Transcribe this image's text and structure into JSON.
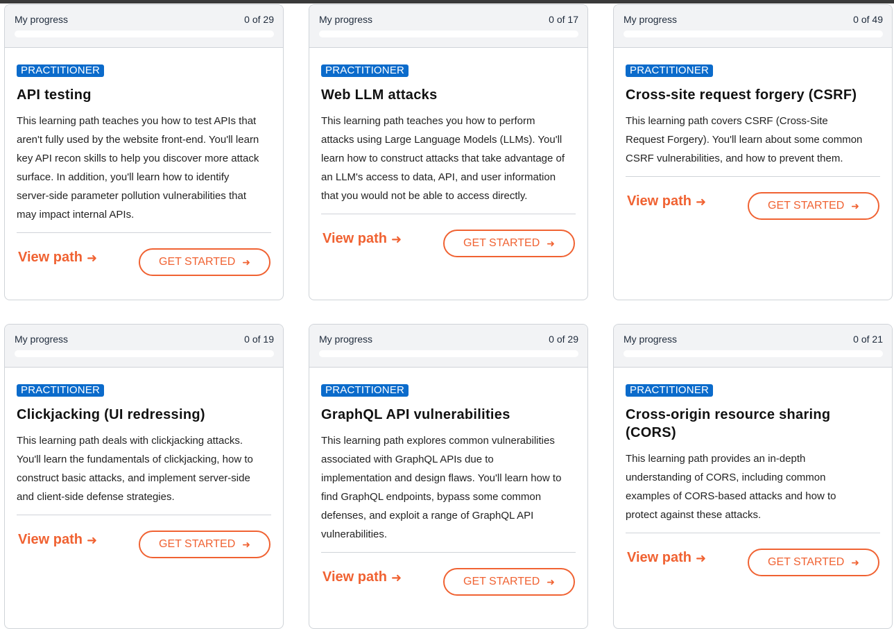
{
  "progress_label": "My progress",
  "badge_label": "PRACTITIONER",
  "view_path_label": "View path",
  "get_started_label": "GET STARTED",
  "accent_color": "#f06232",
  "badge_color": "#0b6bcb",
  "icons": {
    "arrow": "arrow-right-icon"
  },
  "cards": [
    {
      "progress_count": "0 of 29",
      "progress_fraction": 0,
      "title": "API testing",
      "description_lines": [
        "This learning path teaches you how to test APIs that",
        "aren't fully used by the website front-end. You'll learn",
        "key API recon skills to help you discover more attack",
        "surface. In addition, you'll learn how to identify",
        "server-side parameter pollution vulnerabilities that",
        "may impact internal APIs."
      ]
    },
    {
      "progress_count": "0 of 17",
      "progress_fraction": 0,
      "title": "Web LLM attacks",
      "description_lines": [
        "This learning path teaches you how to perform",
        "attacks using Large Language Models (LLMs). You'll",
        "learn how to construct attacks that take advantage of",
        "an LLM's access to data, API, and user information",
        "that you would not be able to access directly."
      ]
    },
    {
      "progress_count": "0 of 49",
      "progress_fraction": 0,
      "title": "Cross-site request forgery (CSRF)",
      "description_lines": [
        "This learning path covers CSRF (Cross-Site",
        "Request Forgery). You'll learn about some common",
        "CSRF vulnerabilities, and how to prevent them."
      ]
    },
    {
      "progress_count": "0 of 19",
      "progress_fraction": 0,
      "title": "Clickjacking (UI redressing)",
      "description_lines": [
        "This learning path deals with clickjacking attacks.",
        "You'll learn the fundamentals of clickjacking, how to",
        "construct basic attacks, and implement server-side",
        "and client-side defense strategies."
      ]
    },
    {
      "progress_count": "0 of 29",
      "progress_fraction": 0,
      "title": "GraphQL API vulnerabilities",
      "description_lines": [
        "This learning path explores common vulnerabilities",
        "associated with GraphQL APIs due to",
        "implementation and design flaws. You'll learn how to",
        "find GraphQL endpoints, bypass some common",
        "defenses, and exploit a range of GraphQL API",
        "vulnerabilities."
      ]
    },
    {
      "progress_count": "0 of 21",
      "progress_fraction": 0,
      "title": "Cross-origin resource sharing (CORS)",
      "description_lines": [
        "This learning path provides an in-depth",
        "understanding of CORS, including common",
        "examples of CORS-based attacks and how to",
        "protect against these attacks."
      ]
    }
  ]
}
